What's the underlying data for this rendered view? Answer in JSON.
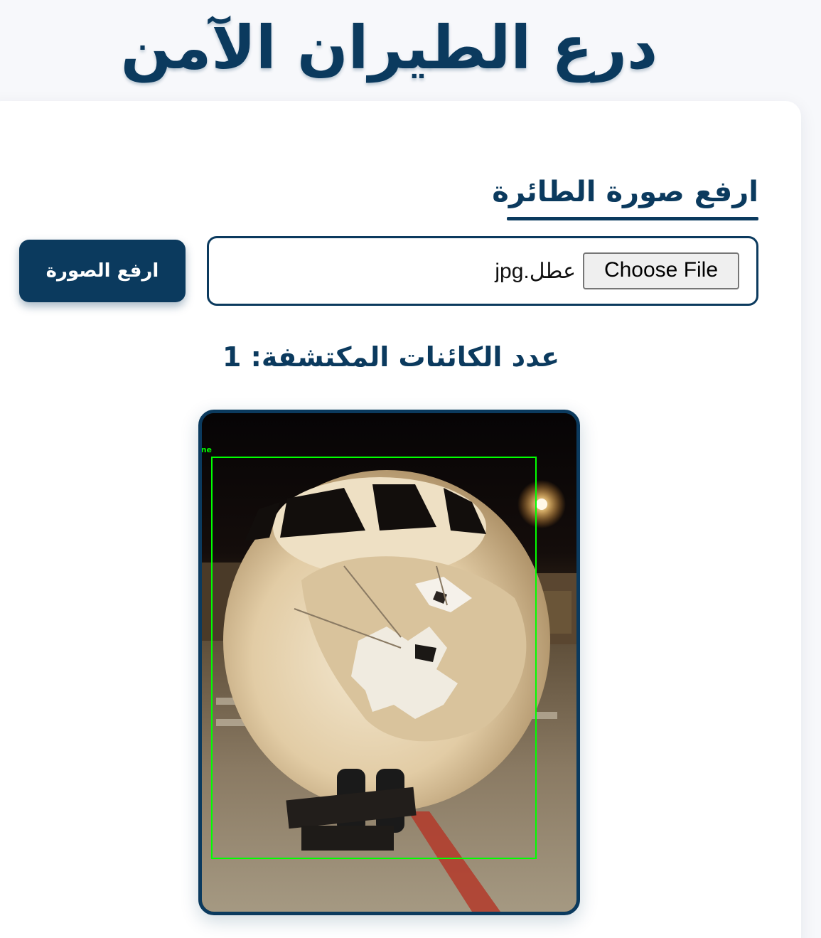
{
  "app": {
    "title": "درع الطيران الآمن"
  },
  "upload": {
    "heading": "ارفع صورة الطائرة",
    "choose_file_label": "Choose File",
    "file_name": "عطل.jpg",
    "submit_label": "ارفع الصورة"
  },
  "results": {
    "count_text": "عدد الكائنات المكتشفة: 1",
    "detections": [
      {
        "label": "airplane"
      }
    ]
  },
  "colors": {
    "primary": "#0b3a5e",
    "background": "#f7f8fb",
    "detection_box": "#00ff00"
  }
}
